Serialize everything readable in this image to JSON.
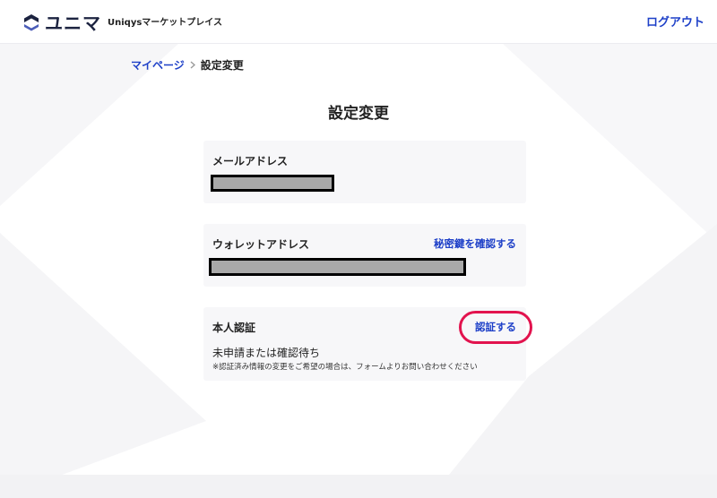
{
  "header": {
    "brand_name": "ユニマ",
    "marketplace_label": "Uniqysマーケットプレイス",
    "logout_label": "ログアウト"
  },
  "breadcrumb": {
    "home_label": "マイページ",
    "current_label": "設定変更"
  },
  "page": {
    "title": "設定変更"
  },
  "email_card": {
    "label": "メールアドレス"
  },
  "wallet_card": {
    "label": "ウォレットアドレス",
    "link_label": "秘密鍵を確認する"
  },
  "identity_card": {
    "label": "本人認証",
    "link_label": "認証する",
    "status": "未申請または確認待ち",
    "note": "※認証済み情報の変更をご希望の場合は、フォームよりお問い合わせください"
  },
  "colors": {
    "accent": "#1e40c8",
    "highlight": "#e2134e",
    "card_bg": "#f7f7f9",
    "redaction": "#a9a9a9"
  }
}
